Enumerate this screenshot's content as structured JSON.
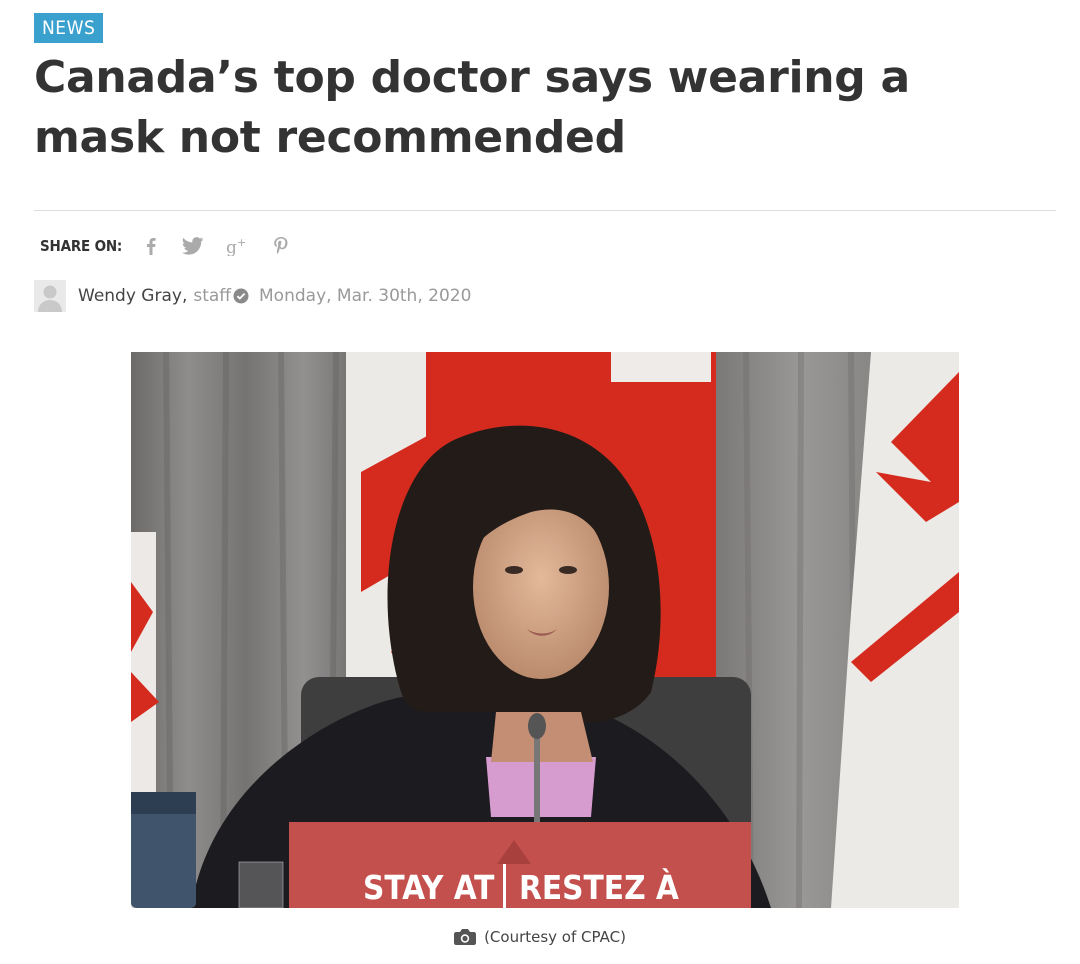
{
  "article": {
    "category": "NEWS",
    "title": "Canada’s top doctor says wearing a mask not recommended"
  },
  "share": {
    "label": "SHARE ON:",
    "icons": [
      "facebook-icon",
      "twitter-icon",
      "google-plus-icon",
      "pinterest-icon"
    ]
  },
  "byline": {
    "author": "Wendy Gray,",
    "role": "staff",
    "date": "Monday, Mar. 30th, 2020"
  },
  "image": {
    "sign_left": "STAY AT",
    "sign_right": "RESTEZ À",
    "caption": "(Courtesy of CPAC)"
  },
  "colors": {
    "category_bg": "#3aa1cf",
    "title_text": "#333333",
    "muted_text": "#999999",
    "flag_red": "#d52b1e",
    "sign_red": "#c4504d"
  }
}
